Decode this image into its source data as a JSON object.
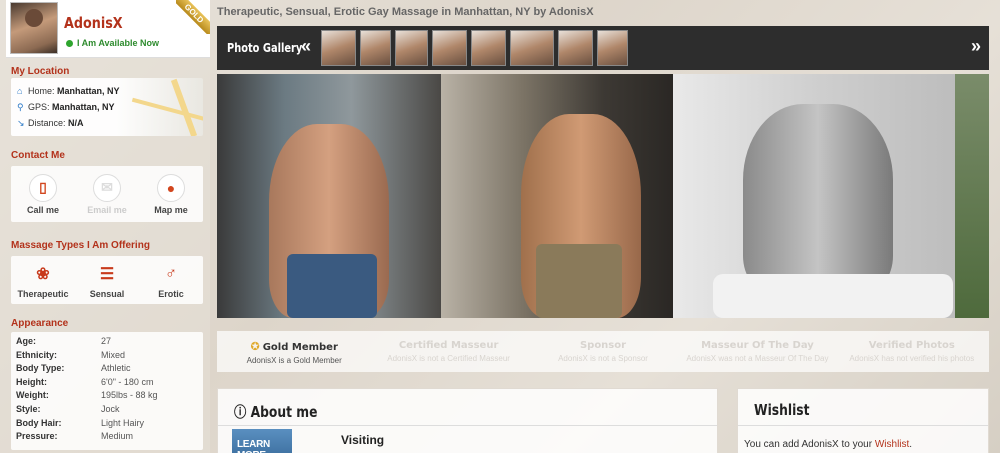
{
  "profile": {
    "name": "AdonisX",
    "status": "I Am Available Now",
    "badge": "GOLD"
  },
  "location": {
    "title": "My Location",
    "home_label": "Home:",
    "home_value": "Manhattan, NY",
    "gps_label": "GPS:",
    "gps_value": "Manhattan, NY",
    "distance_label": "Distance:",
    "distance_value": "N/A"
  },
  "contact": {
    "title": "Contact Me",
    "items": [
      {
        "label": "Call me",
        "icon": "phone-icon"
      },
      {
        "label": "Email me",
        "icon": "mail-icon"
      },
      {
        "label": "Map me",
        "icon": "map-pin-icon"
      }
    ]
  },
  "massage": {
    "title": "Massage Types I Am Offering",
    "items": [
      {
        "label": "Therapeutic",
        "icon": "lotus-icon"
      },
      {
        "label": "Sensual",
        "icon": "massage-table-icon"
      },
      {
        "label": "Erotic",
        "icon": "male-symbol-icon"
      }
    ]
  },
  "appearance": {
    "title": "Appearance",
    "rows": [
      {
        "k": "Age:",
        "v": "27"
      },
      {
        "k": "Ethnicity:",
        "v": "Mixed"
      },
      {
        "k": "Body Type:",
        "v": "Athletic"
      },
      {
        "k": "Height:",
        "v": "6'0\" - 180 cm"
      },
      {
        "k": "Weight:",
        "v": "195lbs - 88 kg"
      },
      {
        "k": "Style:",
        "v": "Jock"
      },
      {
        "k": "Body Hair:",
        "v": "Light Hairy"
      },
      {
        "k": "Pressure:",
        "v": "Medium"
      }
    ]
  },
  "page_title": "Therapeutic, Sensual, Erotic Gay Massage in Manhattan, NY by AdonisX",
  "gallery": {
    "label": "Photo Gallery",
    "prev": "«",
    "next": "»"
  },
  "badges": [
    {
      "title": "Gold Member",
      "sub": "AdonisX is a Gold Member"
    },
    {
      "title": "Certified Masseur",
      "sub": "AdonisX is not a Certified Masseur"
    },
    {
      "title": "Sponsor",
      "sub": "AdonisX is not a Sponsor"
    },
    {
      "title": "Masseur Of The Day",
      "sub": "AdonisX was not a Masseur Of The Day"
    },
    {
      "title": "Verified Photos",
      "sub": "AdonisX has not verified his photos"
    }
  ],
  "about": {
    "title": "About me",
    "learn_more": "LEARN MORE",
    "visiting": "Visiting"
  },
  "wishlist": {
    "title": "Wishlist",
    "text": "You can add AdonisX to your ",
    "link": "Wishlist",
    "after": "."
  }
}
